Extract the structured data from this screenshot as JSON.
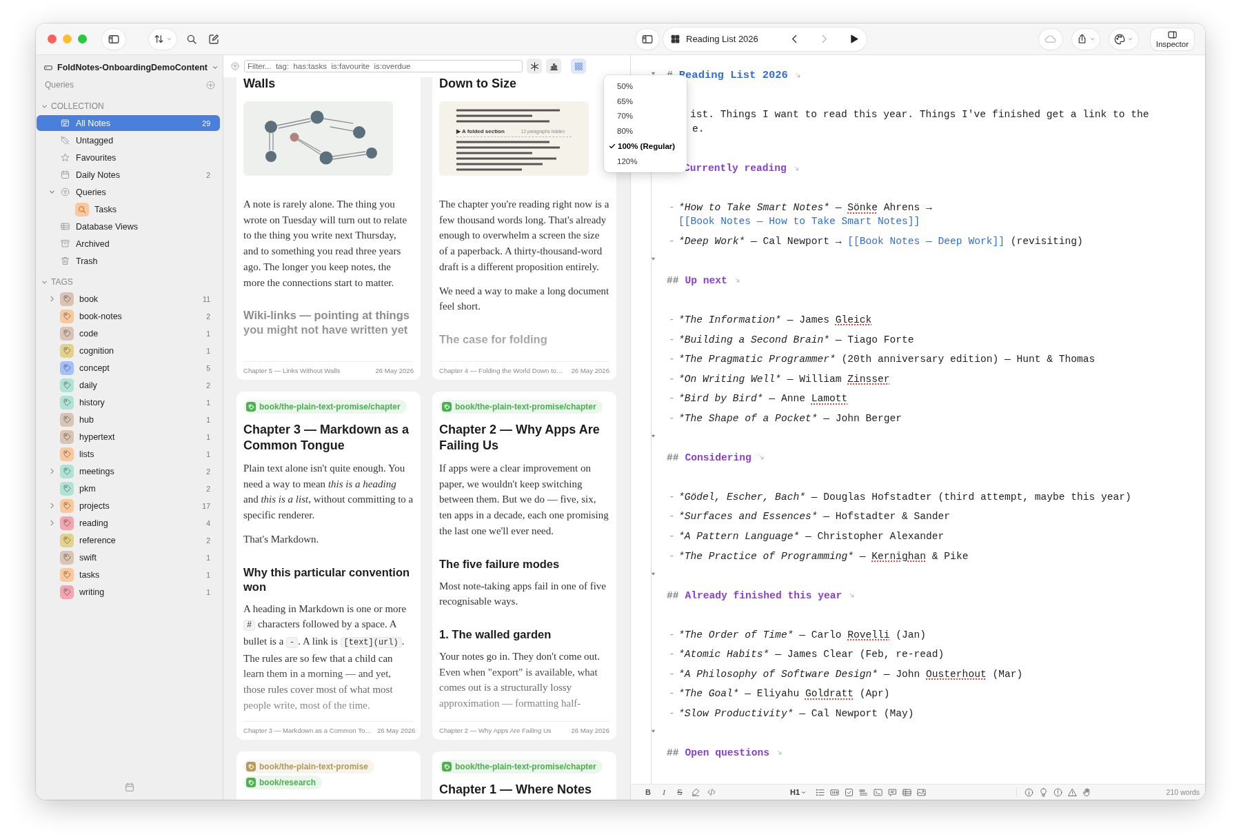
{
  "toolbar": {
    "title": "Reading List 2026",
    "inspector": "Inspector"
  },
  "sidebar": {
    "library": "FoldNotes-OnboardingDemoContent",
    "queries_label": "Queries",
    "sections": [
      {
        "title": "COLLECTION",
        "expanded": true,
        "items": [
          {
            "label": "All Notes",
            "kind": "notes",
            "count": "29",
            "selected": true
          },
          {
            "label": "Untagged",
            "kind": "untagged",
            "selected": false
          },
          {
            "label": "Favourites",
            "kind": "star",
            "selected": false
          },
          {
            "label": "Daily Notes",
            "kind": "calendar",
            "count": "2",
            "selected": false
          },
          {
            "label": "Queries",
            "kind": "filter",
            "selected": false,
            "expanded": true,
            "children": [
              {
                "label": "Tasks",
                "kind": "query",
                "selected": false
              }
            ]
          },
          {
            "label": "Database Views",
            "kind": "table",
            "selected": false
          },
          {
            "label": "Archived",
            "kind": "archive",
            "selected": false
          },
          {
            "label": "Trash",
            "kind": "trash",
            "selected": false
          }
        ]
      },
      {
        "title": "TAGS",
        "expanded": true,
        "items": [
          {
            "label": "book",
            "kind": "tag",
            "color": "#d9c4b3",
            "count": "11",
            "selected": false,
            "expanded": false
          },
          {
            "label": "book-notes",
            "kind": "tag",
            "color": "#f9c89c",
            "count": "2",
            "selected": false
          },
          {
            "label": "code",
            "kind": "tag",
            "color": "#d9c4b3",
            "count": "1",
            "selected": false
          },
          {
            "label": "cognition",
            "kind": "tag",
            "color": "#e2d28c",
            "count": "1",
            "selected": false
          },
          {
            "label": "concept",
            "kind": "tag",
            "color": "#a3c1f7",
            "count": "5",
            "selected": false
          },
          {
            "label": "daily",
            "kind": "tag",
            "color": "#aee3d6",
            "count": "2",
            "selected": false
          },
          {
            "label": "history",
            "kind": "tag",
            "color": "#aee3d6",
            "count": "1",
            "selected": false
          },
          {
            "label": "hub",
            "kind": "tag",
            "color": "#d9c4b3",
            "count": "1",
            "selected": false
          },
          {
            "label": "hypertext",
            "kind": "tag",
            "color": "#d9c4b3",
            "count": "1",
            "selected": false
          },
          {
            "label": "lists",
            "kind": "tag",
            "color": "#f9c89c",
            "count": "1",
            "selected": false
          },
          {
            "label": "meetings",
            "kind": "tag",
            "color": "#aee3d6",
            "count": "2",
            "selected": false,
            "expanded": false
          },
          {
            "label": "pkm",
            "kind": "tag",
            "color": "#aee3d6",
            "count": "2",
            "selected": false
          },
          {
            "label": "projects",
            "kind": "tag",
            "color": "#f9c89c",
            "count": "17",
            "selected": false,
            "expanded": false
          },
          {
            "label": "reading",
            "kind": "tag",
            "color": "#f5a5b0",
            "count": "4",
            "selected": false,
            "expanded": false
          },
          {
            "label": "reference",
            "kind": "tag",
            "color": "#e2d28c",
            "count": "2",
            "selected": false
          },
          {
            "label": "swift",
            "kind": "tag",
            "color": "#d9c4b3",
            "count": "1",
            "selected": false
          },
          {
            "label": "tasks",
            "kind": "tag",
            "color": "#f9c89c",
            "count": "1",
            "selected": false
          },
          {
            "label": "writing",
            "kind": "tag",
            "color": "#f5a5b0",
            "count": "1",
            "selected": false
          }
        ]
      }
    ]
  },
  "note_list": {
    "filter": {
      "placeholder": "Filter...  tag:  has:tasks  is:favourite  is:overdue"
    },
    "view_buttons": [
      {
        "kind": "asterisk",
        "selected": false
      },
      {
        "kind": "chart",
        "selected": false
      },
      {
        "kind": "grid",
        "selected": true
      }
    ],
    "cards": [
      {
        "cut_top": true,
        "title": "Walls",
        "figure": {
          "kind": "graph"
        },
        "body": [
          {
            "kind": "p",
            "text": "A note is rarely alone. The thing you wrote on Tuesday will turn out to relate to the thing you write next Thursday, and to something you read three years ago. The longer you keep notes, the more the connections start to matter."
          },
          {
            "kind": "h",
            "text": "Wiki-links — pointing at things you might not have written yet"
          }
        ],
        "footer": {
          "title": "Chapter 5 — Links Without Walls",
          "date": "26 May 2026"
        }
      },
      {
        "cut_top": true,
        "title": "Down to Size",
        "figure": {
          "kind": "folded",
          "label": "▶ A folded section",
          "note": "12 paragraphs hidden"
        },
        "body": [
          {
            "kind": "p",
            "text": "The chapter you're reading right now is a few thousand words long. That's already enough to overwhelm a screen the size of a paperback. A thirty-thousand-word draft is a different proposition entirely."
          },
          {
            "kind": "p",
            "text": "We need a way to make a long document feel short."
          },
          {
            "kind": "h",
            "text": "The case for folding"
          }
        ],
        "footer": {
          "title": "Chapter 4 — Folding the World Down to…",
          "date": "26 May 2026"
        }
      },
      {
        "cut_top": false,
        "tags": [
          {
            "label": "book/the-plain-text-promise/chapter",
            "color": "#4caf50"
          }
        ],
        "title": "Chapter 3 — Markdown as a Common Tongue",
        "body": [
          {
            "kind": "p",
            "text": "Plain text alone isn't quite enough. You need a way to mean *this is a heading* and *this is a list*, without committing to a specific renderer."
          },
          {
            "kind": "p",
            "text": "That's Markdown."
          },
          {
            "kind": "h",
            "text": "Why this particular convention won"
          },
          {
            "kind": "p",
            "segments": [
              {
                "kind": "text",
                "text": "A heading in Markdown is one or more "
              },
              {
                "kind": "code",
                "text": "#"
              },
              {
                "kind": "text",
                "text": " characters followed by a space. A bullet is a "
              },
              {
                "kind": "code",
                "text": "-"
              },
              {
                "kind": "text",
                "text": ". A link is "
              },
              {
                "kind": "code",
                "text": "[text](url)"
              },
              {
                "kind": "text",
                "text": ". The rules are so few that a child can learn them in a morning — and yet, those rules cover most of what most people write, most of the time."
              }
            ]
          }
        ],
        "footer": {
          "title": "Chapter 3 — Markdown as a Common To…",
          "date": "26 May 2026"
        }
      },
      {
        "cut_top": false,
        "tags": [
          {
            "label": "book/the-plain-text-promise/chapter",
            "color": "#4caf50"
          }
        ],
        "title": "Chapter 2 — Why Apps Are Failing Us",
        "body": [
          {
            "kind": "p",
            "text": "If apps were a clear improvement on paper, we wouldn't keep switching between them. But we do — five, six, ten apps in a decade, each one promising the last one we'll ever need."
          },
          {
            "kind": "h",
            "text": "The five failure modes"
          },
          {
            "kind": "p",
            "text": "Most note-taking apps fail in one of five recognisable ways."
          },
          {
            "kind": "h",
            "text": "1. The walled garden"
          },
          {
            "kind": "p",
            "text": "Your notes go in. They don't come out. Even when \"export\" is available, what comes out is a structurally lossy approximation — formatting half-"
          }
        ],
        "footer": {
          "title": "Chapter 2 — Why Apps Are Failing Us",
          "date": "26 May 2026"
        }
      },
      {
        "cut_top": false,
        "tags": [
          {
            "label": "book/the-plain-text-promise",
            "color": "#b39a5c"
          },
          {
            "label": "book/research",
            "color": "#4caf50"
          }
        ]
      },
      {
        "cut_top": false,
        "tags": [
          {
            "label": "book/the-plain-text-promise/chapter",
            "color": "#4caf50"
          }
        ],
        "title": "Chapter 1 — Where Notes"
      }
    ]
  },
  "zoom_menu": {
    "items": [
      {
        "label": "50%",
        "selected": false
      },
      {
        "label": "65%",
        "selected": false
      },
      {
        "label": "70%",
        "selected": false
      },
      {
        "label": "80%",
        "selected": false
      },
      {
        "label": "100% (Regular)",
        "selected": true
      },
      {
        "label": "120%",
        "selected": false
      }
    ]
  },
  "editor": {
    "blocks": [
      {
        "kind": "h1",
        "marker": "#",
        "title": "Reading List 2026",
        "expanded": true
      },
      {
        "kind": "para",
        "lines": [
          "ist. Things I want to read this year. Things I've finished get a link to the",
          "e."
        ]
      },
      {
        "kind": "h2",
        "title": "Currently reading"
      },
      {
        "kind": "item",
        "marker": "-",
        "segments": [
          {
            "kind": "emph",
            "text": "*How to Take Smart Notes*"
          },
          {
            "kind": "text",
            "text": " — "
          },
          {
            "kind": "misspelled",
            "text": "Sönke"
          },
          {
            "kind": "text",
            "text": " Ahrens → "
          },
          {
            "kind": "link",
            "text": "[[Book Notes — How to Take Smart Notes]]"
          }
        ]
      },
      {
        "kind": "item",
        "marker": "-",
        "segments": [
          {
            "kind": "emph",
            "text": "*Deep Work*"
          },
          {
            "kind": "text",
            "text": " — Cal Newport → "
          },
          {
            "kind": "link",
            "text": "[[Book Notes — Deep Work]]"
          },
          {
            "kind": "text",
            "text": " (revisiting)"
          }
        ]
      },
      {
        "kind": "h2",
        "marker": "##",
        "title": "Up next",
        "expanded": true
      },
      {
        "kind": "item",
        "marker": "-",
        "segments": [
          {
            "kind": "emph",
            "text": "*The Information*"
          },
          {
            "kind": "text",
            "text": " — James "
          },
          {
            "kind": "misspelled",
            "text": "Gleick"
          }
        ]
      },
      {
        "kind": "item",
        "marker": "-",
        "segments": [
          {
            "kind": "emph",
            "text": "*Building a Second Brain*"
          },
          {
            "kind": "text",
            "text": " — Tiago Forte"
          }
        ]
      },
      {
        "kind": "item",
        "marker": "-",
        "segments": [
          {
            "kind": "emph",
            "text": "*The Pragmatic Programmer*"
          },
          {
            "kind": "text",
            "text": " (20th anniversary edition) — Hunt & Thomas"
          }
        ]
      },
      {
        "kind": "item",
        "marker": "-",
        "segments": [
          {
            "kind": "emph",
            "text": "*On Writing Well*"
          },
          {
            "kind": "text",
            "text": " — William "
          },
          {
            "kind": "misspelled",
            "text": "Zinsser"
          }
        ]
      },
      {
        "kind": "item",
        "marker": "-",
        "segments": [
          {
            "kind": "emph",
            "text": "*Bird by Bird*"
          },
          {
            "kind": "text",
            "text": " — Anne "
          },
          {
            "kind": "misspelled",
            "text": "Lamott"
          }
        ]
      },
      {
        "kind": "item",
        "marker": "-",
        "segments": [
          {
            "kind": "emph",
            "text": "*The Shape of a Pocket*"
          },
          {
            "kind": "text",
            "text": " — John Berger"
          }
        ]
      },
      {
        "kind": "h2",
        "marker": "##",
        "title": "Considering",
        "expanded": true
      },
      {
        "kind": "item",
        "marker": "-",
        "segments": [
          {
            "kind": "emph",
            "text": "*Gödel, Escher, Bach*"
          },
          {
            "kind": "text",
            "text": " — Douglas Hofstadter (third attempt, maybe this year)"
          }
        ]
      },
      {
        "kind": "item",
        "marker": "-",
        "segments": [
          {
            "kind": "emph",
            "text": "*Surfaces and Essences*"
          },
          {
            "kind": "text",
            "text": " — Hofstadter & Sander"
          }
        ]
      },
      {
        "kind": "item",
        "marker": "-",
        "segments": [
          {
            "kind": "emph",
            "text": "*A Pattern Language*"
          },
          {
            "kind": "text",
            "text": " — Christopher Alexander"
          }
        ]
      },
      {
        "kind": "item",
        "marker": "-",
        "segments": [
          {
            "kind": "emph",
            "text": "*The Practice of Programming*"
          },
          {
            "kind": "text",
            "text": " — "
          },
          {
            "kind": "misspelled",
            "text": "Kernighan"
          },
          {
            "kind": "text",
            "text": " & Pike"
          }
        ]
      },
      {
        "kind": "h2",
        "marker": "##",
        "title": "Already finished this year",
        "expanded": true
      },
      {
        "kind": "item",
        "marker": "-",
        "segments": [
          {
            "kind": "emph",
            "text": "*The Order of Time*"
          },
          {
            "kind": "text",
            "text": " — Carlo "
          },
          {
            "kind": "misspelled",
            "text": "Rovelli"
          },
          {
            "kind": "text",
            "text": " (Jan)"
          }
        ]
      },
      {
        "kind": "item",
        "marker": "-",
        "segments": [
          {
            "kind": "emph",
            "text": "*Atomic Habits*"
          },
          {
            "kind": "text",
            "text": " — James Clear (Feb, re-read)"
          }
        ]
      },
      {
        "kind": "item",
        "marker": "-",
        "segments": [
          {
            "kind": "emph",
            "text": "*A Philosophy of Software Design*"
          },
          {
            "kind": "text",
            "text": " — John "
          },
          {
            "kind": "misspelled",
            "text": "Ousterhout"
          },
          {
            "kind": "text",
            "text": " (Mar)"
          }
        ]
      },
      {
        "kind": "item",
        "marker": "-",
        "segments": [
          {
            "kind": "emph",
            "text": "*The Goal*"
          },
          {
            "kind": "text",
            "text": " — Eliyahu "
          },
          {
            "kind": "misspelled",
            "text": "Goldratt"
          },
          {
            "kind": "text",
            "text": " (Apr)"
          }
        ]
      },
      {
        "kind": "item",
        "marker": "-",
        "segments": [
          {
            "kind": "emph",
            "text": "*Slow Productivity*"
          },
          {
            "kind": "text",
            "text": " — Cal Newport (May)"
          }
        ]
      },
      {
        "kind": "h2",
        "marker": "##",
        "title": "Open questions",
        "expanded": true
      }
    ],
    "format_bar": {
      "left": [
        {
          "kind": "bold",
          "label": "B"
        },
        {
          "kind": "italic",
          "label": "I"
        },
        {
          "kind": "strike",
          "label": "S"
        },
        {
          "kind": "highlight"
        },
        {
          "kind": "code"
        }
      ],
      "heading": "H1",
      "blocks": [
        {
          "kind": "ulist"
        },
        {
          "kind": "olist"
        },
        {
          "kind": "checkbox"
        },
        {
          "kind": "quote"
        },
        {
          "kind": "terminal"
        },
        {
          "kind": "comment"
        },
        {
          "kind": "table"
        },
        {
          "kind": "image"
        }
      ],
      "callouts": [
        {
          "kind": "info"
        },
        {
          "kind": "bulb"
        },
        {
          "kind": "excl"
        },
        {
          "kind": "warn"
        },
        {
          "kind": "hand"
        }
      ],
      "word_count": "210 words"
    }
  }
}
